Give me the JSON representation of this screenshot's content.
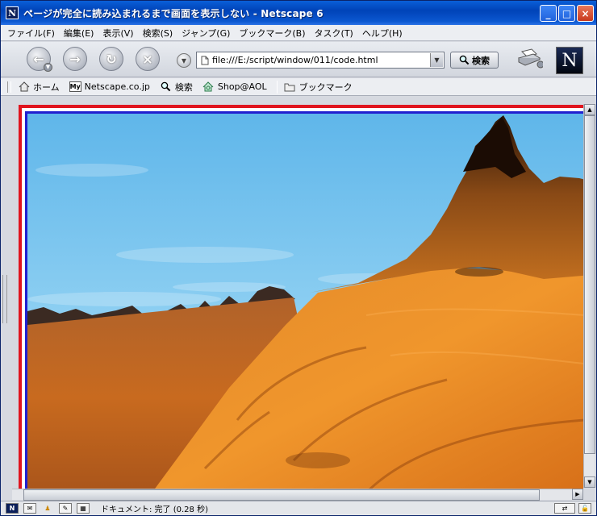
{
  "window": {
    "title": "ページが完全に読み込まれるまで画面を表示しない - Netscape 6",
    "app_icon_glyph": "N",
    "minimize_glyph": "_",
    "maximize_glyph": "□",
    "close_glyph": "×"
  },
  "menu": [
    "ファイル(F)",
    "編集(E)",
    "表示(V)",
    "検索(S)",
    "ジャンプ(G)",
    "ブックマーク(B)",
    "タスク(T)",
    "ヘルプ(H)"
  ],
  "nav": {
    "back_glyph": "←",
    "forward_glyph": "→",
    "reload_glyph": "↻",
    "stop_glyph": "×",
    "url": "file:///E:/script/window/011/code.html",
    "search_label": "検索",
    "logo_glyph": "N"
  },
  "bookmarks": [
    {
      "label": "ホーム",
      "icon": "home-icon"
    },
    {
      "label": "Netscape.co.jp",
      "icon": "my-icon",
      "badge": "My"
    },
    {
      "label": "検索",
      "icon": "search-icon"
    },
    {
      "label": "Shop@AOL",
      "icon": "shop-icon"
    },
    {
      "label": "ブックマーク",
      "icon": "folder-icon"
    }
  ],
  "status": {
    "text": "ドキュメント: 完了 (0.28 秒)"
  },
  "colors": {
    "titlebar": "#0a5fd8",
    "page_border_outer": "#e0141e",
    "page_border_inner": "#2020d0",
    "sky": "#7cc6ee",
    "terrain": "#e07a1a"
  }
}
